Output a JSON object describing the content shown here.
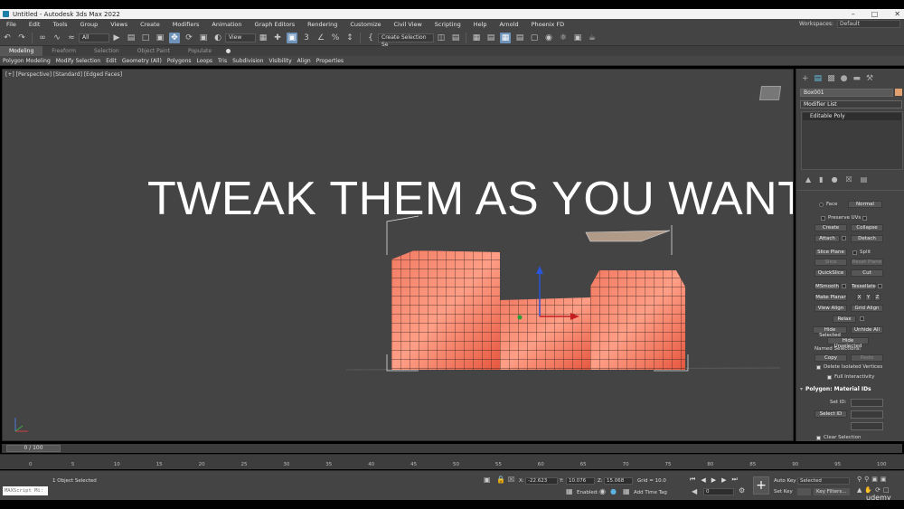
{
  "window": {
    "title": "Untitled - Autodesk 3ds Max 2022"
  },
  "menu": [
    "File",
    "Edit",
    "Tools",
    "Group",
    "Views",
    "Create",
    "Modifiers",
    "Animation",
    "Graph Editors",
    "Rendering",
    "Customize",
    "Civil View",
    "Scripting",
    "Help",
    "Arnold",
    "Phoenix FD"
  ],
  "workspace": {
    "label": "Workspaces:",
    "value": "Default"
  },
  "toolbar": {
    "filter": "All",
    "refcoord": "View",
    "selset": "Create Selection Se"
  },
  "ribbon_tabs": [
    "Modeling",
    "Freeform",
    "Selection",
    "Object Paint",
    "Populate"
  ],
  "ribbon_items": [
    "Polygon Modeling",
    "Modify Selection",
    "Edit",
    "Geometry (All)",
    "Polygons",
    "Loops",
    "Tris",
    "Subdivision",
    "Visibility",
    "Align",
    "Properties"
  ],
  "viewport": {
    "label": "[+] [Perspective] [Standard] [Edged Faces]",
    "overlay": "TWEAK THEM AS YOU WANT"
  },
  "command_panel": {
    "object_name": "Box001",
    "modifier_list": "Modifier List",
    "stack_item": "Editable Poly",
    "face_label": "Face",
    "normal_label": "Normal",
    "preserve_uvs": "Preserve UVs",
    "btn_create": "Create",
    "btn_collapse": "Collapse",
    "btn_attach": "Attach",
    "btn_detach": "Detach",
    "btn_slice_plane": "Slice Plane",
    "lbl_split": "Split",
    "btn_slice": "Slice",
    "btn_reset_plane": "Reset Plane",
    "btn_quickslice": "QuickSlice",
    "btn_cut": "Cut",
    "btn_msmooth": "MSmooth",
    "btn_tessellate": "Tessellate",
    "btn_make_planar": "Make Planar",
    "lbl_x": "X",
    "lbl_y": "Y",
    "lbl_z": "Z",
    "btn_view_align": "View Align",
    "btn_grid_align": "Grid Align",
    "btn_relax": "Relax",
    "btn_hide_selected": "Hide Selected",
    "btn_unhide_all": "Unhide All",
    "btn_hide_unselected": "Hide Unselected",
    "named_selections": "Named Selections:",
    "btn_copy": "Copy",
    "btn_paste": "Paste",
    "delete_isolated": "Delete Isolated Vertices",
    "full_interactivity": "Full Interactivity",
    "rollout_material": "Polygon: Material IDs",
    "set_id": "Set ID:",
    "select_id": "Select ID",
    "clear_selection": "Clear Selection"
  },
  "timeline": {
    "slider": "0 / 100",
    "ticks": [
      "0",
      "5",
      "10",
      "15",
      "20",
      "25",
      "30",
      "35",
      "40",
      "45",
      "50",
      "55",
      "60",
      "65",
      "70",
      "75",
      "80",
      "85",
      "90",
      "95",
      "100"
    ]
  },
  "status": {
    "maxscript": "MAXScript Mi:",
    "selected": "1 Object Selected",
    "x_label": "X:",
    "x": "-22.623",
    "y_label": "Y:",
    "y": "10.076",
    "z_label": "Z:",
    "z": "15.068",
    "grid": "Grid = 10.0",
    "enabled": "Enabled:",
    "add_time_tag": "Add Time Tag",
    "auto_key": "Auto Key",
    "set_key": "Set Key",
    "key_mode": "Selected",
    "key_filters": "Key Filters...",
    "frame": "0",
    "watermark": "udemy"
  }
}
